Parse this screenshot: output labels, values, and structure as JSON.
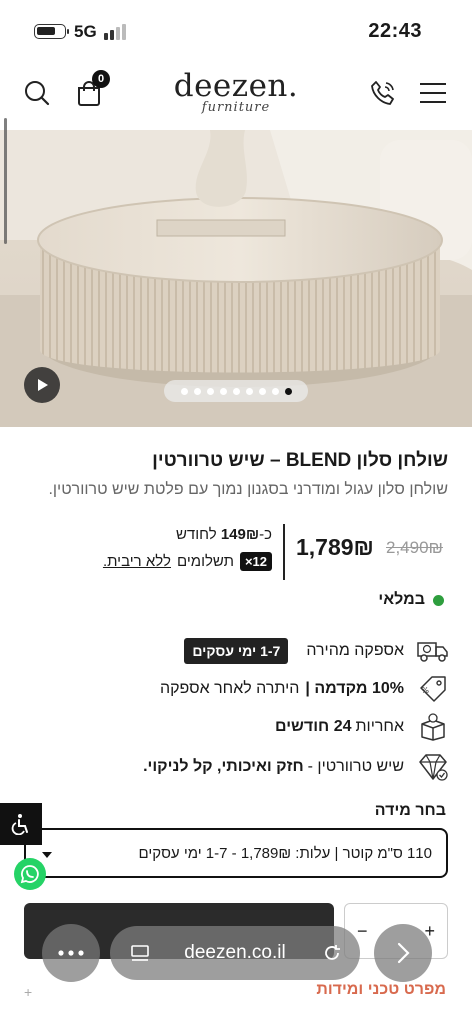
{
  "status_bar": {
    "time": "22:43",
    "network": "5G"
  },
  "header": {
    "logo": "deezen.",
    "logo_sub": "furniture",
    "cart_count": "0"
  },
  "gallery": {
    "dot_count": 9,
    "active_dot": 8
  },
  "product": {
    "title": "שולחן סלון BLEND – שיש טרוורטין",
    "subtitle": "שולחן סלון עגול ומודרני בסגנון נמוך עם פלטת שיש טרוורטין.",
    "old_price": "2,490₪",
    "price": "1,789₪",
    "monthly_prefix": "כ-",
    "monthly_amount": "149₪",
    "monthly_suffix": "לחודש",
    "payments_badge": "12×",
    "payments_text": "תשלומים",
    "payments_link": "ללא ריבית.",
    "stock": "במלאי"
  },
  "features": [
    {
      "icon": "delivery-truck-icon",
      "text": "אספקה מהירה",
      "tag": "1-7 ימי עסקים"
    },
    {
      "icon": "price-tag-icon",
      "bold": "10% מקדמה |",
      "text": "היתרה לאחר אספקה"
    },
    {
      "icon": "warranty-box-icon",
      "text": "אחריות",
      "bold": "24 חודשים"
    },
    {
      "icon": "diamond-icon",
      "text": "שיש טרוורטין -",
      "bold": "חזק ואיכותי, קל לניקוי."
    }
  ],
  "size": {
    "label": "בחר מידה",
    "selected": "110 ס\"מ קוטר | עלות: 1,789₪ - 1-7 ימי עסקים"
  },
  "cart": {
    "qty_minus": "−",
    "qty_plus": "+"
  },
  "browser": {
    "url": "deezen.co.il"
  },
  "spec_label": "מפרט טכני ומידות",
  "colors": {
    "in_stock": "#2e9e3e",
    "accent": "#d86a4e",
    "whatsapp": "#25d366"
  }
}
